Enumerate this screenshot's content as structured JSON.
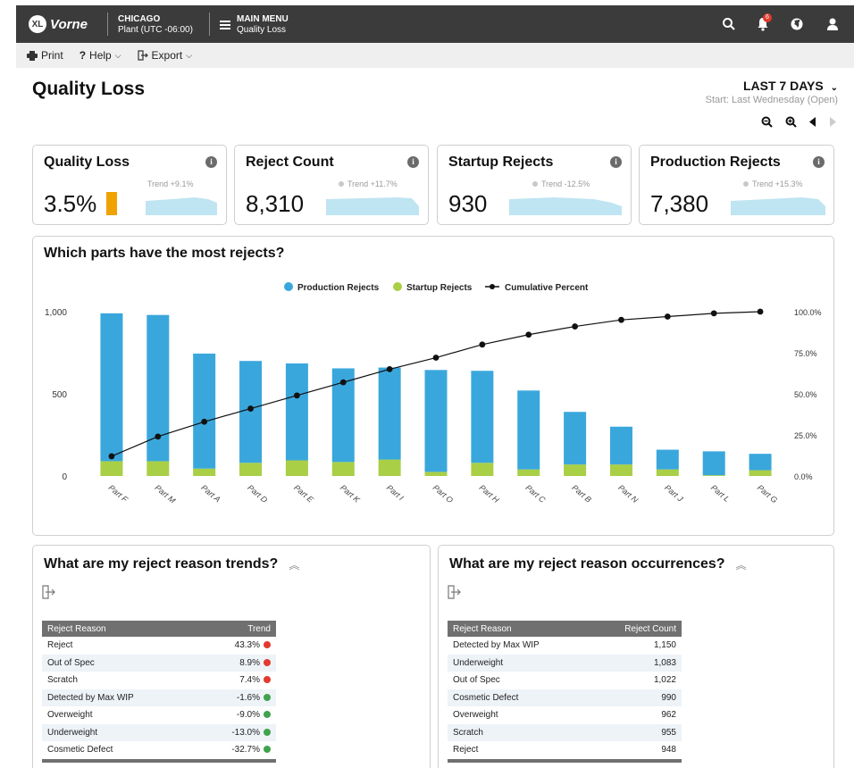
{
  "app": {
    "logo_badge": "XL",
    "logo_text": "Vorne",
    "plant_name": "CHICAGO",
    "plant_sub": "Plant (UTC -06:00)",
    "menu_label": "MAIN MENU",
    "menu_sub": "Quality Loss",
    "notification_count": "6"
  },
  "toolbar": {
    "print": "Print",
    "help": "Help",
    "export": "Export"
  },
  "header": {
    "title": "Quality Loss",
    "range_label": "LAST 7 DAYS",
    "range_sub": "Start: Last Wednesday (Open)"
  },
  "kpis": [
    {
      "title": "Quality Loss",
      "value": "3.5%",
      "trend": "Trend +9.1%"
    },
    {
      "title": "Reject Count",
      "value": "8,310",
      "trend": "Trend +11.7%"
    },
    {
      "title": "Startup Rejects",
      "value": "930",
      "trend": "Trend -12.5%"
    },
    {
      "title": "Production Rejects",
      "value": "7,380",
      "trend": "Trend +15.3%"
    }
  ],
  "colors": {
    "production": "#3aa7dc",
    "startup": "#a9cf46",
    "cumulative": "#111111",
    "trend_up": "#e23b2e",
    "trend_down": "#3fa34d",
    "kpi_bar": "#f0a300",
    "spark": "#bfe4f2"
  },
  "chart_panel": {
    "title": "Which parts have the most rejects?"
  },
  "chart_data": {
    "type": "bar",
    "stacked": true,
    "categories": [
      "Part F",
      "Part M",
      "Part A",
      "Part D",
      "Part E",
      "Part K",
      "Part I",
      "Part O",
      "Part H",
      "Part C",
      "Part B",
      "Part N",
      "Part J",
      "Part L",
      "Part G"
    ],
    "series": [
      {
        "name": "Production Rejects",
        "values": [
          900,
          890,
          700,
          620,
          590,
          570,
          560,
          620,
          560,
          480,
          320,
          230,
          120,
          145,
          100
        ]
      },
      {
        "name": "Startup Rejects",
        "values": [
          90,
          90,
          45,
          80,
          95,
          85,
          100,
          25,
          80,
          40,
          70,
          70,
          40,
          5,
          35
        ]
      },
      {
        "name": "Cumulative Percent",
        "axis": "right",
        "values": [
          12,
          24,
          33,
          41,
          49,
          57,
          65,
          72,
          80,
          86,
          91,
          95,
          97,
          99,
          100
        ]
      }
    ],
    "y_ticks": [
      "1,000",
      "500",
      "0"
    ],
    "y2_ticks": [
      "100.0%",
      "75.0%",
      "50.0%",
      "25.0%",
      "0.0%"
    ],
    "ylim": [
      0,
      1000
    ],
    "y2lim": [
      0,
      100
    ],
    "legend_position": "top-center",
    "grid": false
  },
  "trends_panel": {
    "title": "What are my reject reason trends?",
    "col1": "Reject Reason",
    "col2": "Trend",
    "rows": [
      {
        "reason": "Reject",
        "value": "43.3%",
        "status": "up"
      },
      {
        "reason": "Out of Spec",
        "value": "8.9%",
        "status": "up"
      },
      {
        "reason": "Scratch",
        "value": "7.4%",
        "status": "up"
      },
      {
        "reason": "Detected by Max WIP",
        "value": "-1.6%",
        "status": "down"
      },
      {
        "reason": "Overweight",
        "value": "-9.0%",
        "status": "down"
      },
      {
        "reason": "Underweight",
        "value": "-13.0%",
        "status": "down"
      },
      {
        "reason": "Cosmetic Defect",
        "value": "-32.7%",
        "status": "down"
      }
    ]
  },
  "occurrences_panel": {
    "title": "What are my reject reason occurrences?",
    "col1": "Reject Reason",
    "col2": "Reject Count",
    "rows": [
      {
        "reason": "Detected by Max WIP",
        "value": "1,150"
      },
      {
        "reason": "Underweight",
        "value": "1,083"
      },
      {
        "reason": "Out of Spec",
        "value": "1,022"
      },
      {
        "reason": "Cosmetic Defect",
        "value": "990"
      },
      {
        "reason": "Overweight",
        "value": "962"
      },
      {
        "reason": "Scratch",
        "value": "955"
      },
      {
        "reason": "Reject",
        "value": "948"
      }
    ]
  }
}
